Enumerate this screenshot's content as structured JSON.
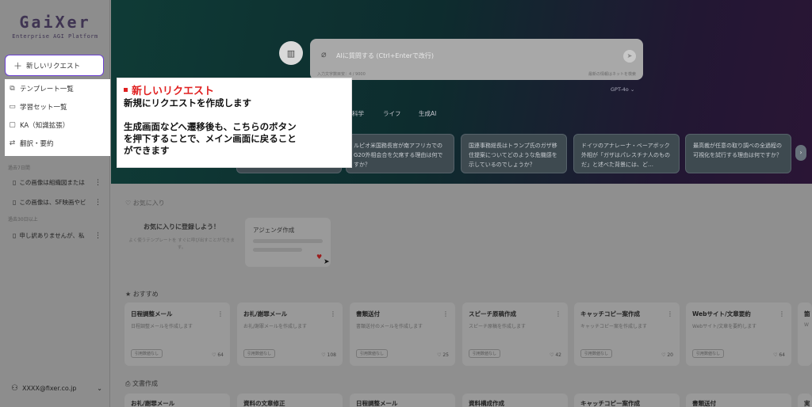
{
  "app": {
    "logo": "GaiXer",
    "logo_sub": "Enterprise AGI Platform"
  },
  "sidebar": {
    "new_request": "新しいリクエスト",
    "menu": [
      {
        "icon": "copy-icon",
        "label": "テンプレート一覧"
      },
      {
        "icon": "book-icon",
        "label": "学習セット一覧"
      },
      {
        "icon": "chat-icon",
        "label": "KA（知識拡張）"
      },
      {
        "icon": "translate-icon",
        "label": "翻訳・要約"
      }
    ],
    "history_label_1": "過去7日間",
    "history_label_2": "過去30日以上",
    "history": [
      "この画像は組織図または",
      "この画像は、SF映画やビ",
      "申し訳ありませんが、私"
    ],
    "user": "XXXX@fixer.co.jp"
  },
  "hero": {
    "search_placeholder": "AIに質問する (Ctrl+Enterで改行)",
    "char_count": "入力文字数目安：4 / 9000",
    "hint": "最新の情報はネットを検索",
    "model": "GPT-4o",
    "categories": [
      "科学",
      "ライフ",
      "生成AI"
    ],
    "question_cards": [
      "",
      "ルピオ米国務長官が南アフリカでのG20外相会合を欠席する理由は何ですか？",
      "国連事務総長はトランプ氏のガザ移住提案についてどのような危機感を示しているのでしょうか？",
      "ドイツのアナレーナ・ベーアボック外相が「ガザはパレスチナ人のものだ」と述べた背景には、ど…",
      "最高裁が任意の取り調べの全過程の可視化を試行する理由は何ですか？"
    ]
  },
  "favorites": {
    "title": "お気に入り",
    "empty_title": "お気に入りに登録しよう！",
    "empty_desc": "よく使うテンプレートを すぐに呼び出すことができます。",
    "agenda": "アジェンダ作成"
  },
  "recommended": {
    "title": "おすすめ",
    "cards": [
      {
        "title": "日程調整メール",
        "desc": "日程調整メールを作成します",
        "tag": "引用数値なし",
        "likes": "64"
      },
      {
        "title": "お礼/謝罪メール",
        "desc": "お礼/謝罪メールを作成します",
        "tag": "引用数値なし",
        "likes": "108"
      },
      {
        "title": "書類送付",
        "desc": "書類送付のメールを作成します",
        "tag": "引用数値なし",
        "likes": "25"
      },
      {
        "title": "スピーチ原稿作成",
        "desc": "スピーチ原稿を作成します",
        "tag": "引用数値なし",
        "likes": "42"
      },
      {
        "title": "キャッチコピー案作成",
        "desc": "キャッチコピー案を作成します",
        "tag": "引用数値なし",
        "likes": "20"
      },
      {
        "title": "Webサイト/文章要約",
        "desc": "Webサイト/文章を要約します",
        "tag": "引用数値なし",
        "likes": "64"
      },
      {
        "title": "箇",
        "desc": "W",
        "tag": "",
        "likes": ""
      }
    ]
  },
  "documents": {
    "title": "文書作成",
    "cards": [
      "お礼/謝罪メール",
      "資料の文章修正",
      "日程調整メール",
      "資料構成作成",
      "キャッチコピー案作成",
      "書類送付",
      "実"
    ]
  },
  "tooltip": {
    "title": "新しいリクエスト",
    "line1": "新規にリクエストを作成します",
    "line2": "生成画面などへ遷移後も、こちらのボタン",
    "line3": "を押下することで、メイン画面に戻ること",
    "line4": "ができます"
  }
}
